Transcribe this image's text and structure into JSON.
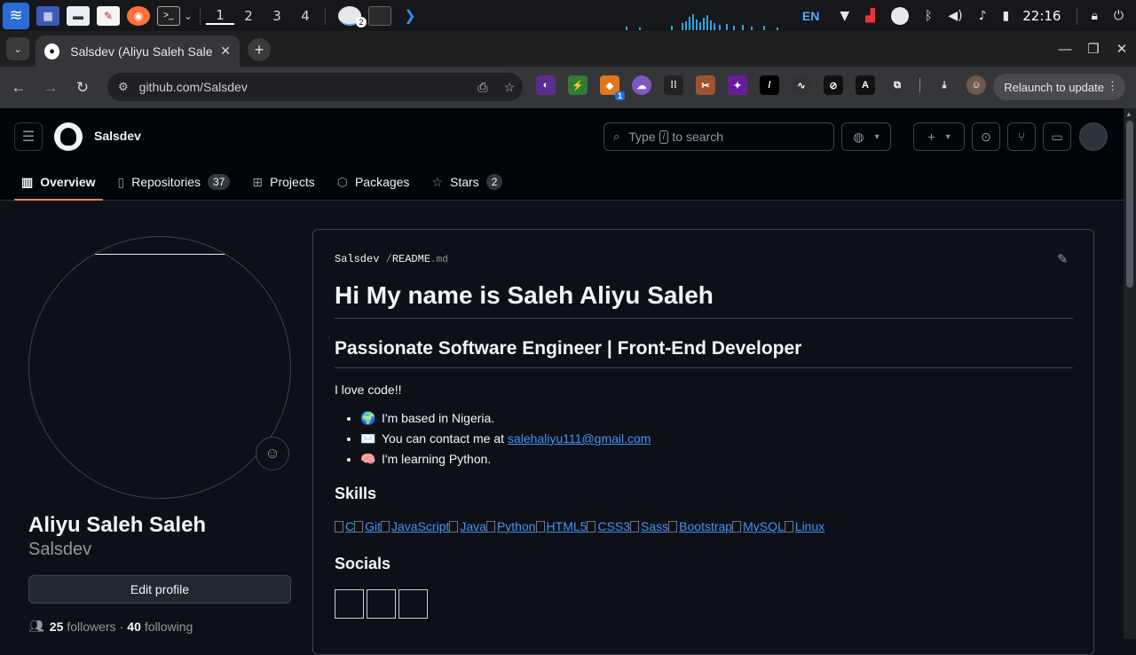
{
  "taskbar": {
    "workspaces": [
      "1",
      "2",
      "3",
      "4"
    ],
    "language": "EN",
    "clock": "22:16",
    "chrome_badge": "2"
  },
  "browser": {
    "tab_title": "Salsdev (Aliyu Saleh Saleh)",
    "url": "github.com/Salsdev",
    "relaunch_label": "Relaunch to update",
    "ext_badge": "1"
  },
  "github": {
    "username": "Salsdev",
    "search_prefix": "Type",
    "search_key": "/",
    "search_suffix": "to search",
    "nav": [
      {
        "label": "Overview"
      },
      {
        "label": "Repositories",
        "count": "37"
      },
      {
        "label": "Projects"
      },
      {
        "label": "Packages"
      },
      {
        "label": "Stars",
        "count": "2"
      }
    ]
  },
  "profile": {
    "full_name": "Aliyu Saleh Saleh",
    "login": "Salsdev",
    "edit_label": "Edit profile",
    "followers_count": "25",
    "followers_label": "followers",
    "following_count": "40",
    "following_label": "following",
    "separator": "·"
  },
  "readme": {
    "owner": "Salsdev",
    "slash": "/",
    "file_name": "README",
    "file_ext": ".md",
    "heading": "Hi My name is Saleh Aliyu Saleh",
    "subheading": "Passionate Software Engineer | Front-End Developer",
    "intro": "I love code!!",
    "bullets": [
      {
        "emoji": "🌍",
        "text": "I'm based in Nigeria."
      },
      {
        "emoji": "✉️",
        "text": "You can contact me at ",
        "link": "salehaliyu111@gmail.com"
      },
      {
        "emoji": "🧠",
        "text": "I'm learning Python."
      }
    ],
    "skills_title": "Skills",
    "skills": [
      "C",
      "Git",
      "JavaScript",
      "Java",
      "Python",
      "HTML5",
      "CSS3",
      "Sass",
      "Bootstrap",
      "MySQL",
      "Linux"
    ],
    "socials_title": "Socials"
  }
}
